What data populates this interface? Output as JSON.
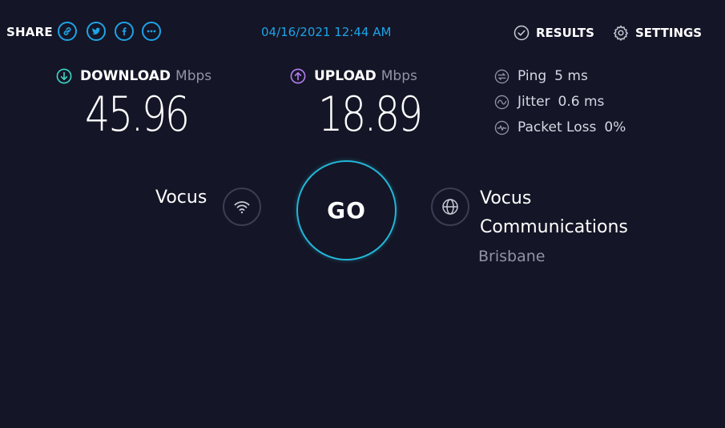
{
  "header": {
    "share_label": "SHARE",
    "share_buttons": [
      "link-icon",
      "twitter-icon",
      "facebook-icon",
      "more-icon"
    ],
    "datetime": "04/16/2021 12:44 AM",
    "results_label": "RESULTS",
    "settings_label": "SETTINGS"
  },
  "download": {
    "label": "DOWNLOAD",
    "unit": "Mbps",
    "value": "45.96",
    "icon": "download-arrow-icon",
    "color": "#3dd9c6"
  },
  "upload": {
    "label": "UPLOAD",
    "unit": "Mbps",
    "value": "18.89",
    "icon": "upload-arrow-icon",
    "color": "#b57ff2"
  },
  "stats": {
    "ping": {
      "label": "Ping",
      "value": "5 ms"
    },
    "jitter": {
      "label": "Jitter",
      "value": "0.6 ms"
    },
    "packet_loss": {
      "label": "Packet Loss",
      "value": "0%"
    }
  },
  "connection": {
    "isp": "Vocus",
    "go_label": "GO",
    "server_line1": "Vocus",
    "server_line2": "Communications",
    "server_location": "Brisbane"
  },
  "colors": {
    "background": "#141526",
    "accent": "#1ea3e6",
    "go_ring": "#23b6d6",
    "muted": "#9193a8"
  }
}
